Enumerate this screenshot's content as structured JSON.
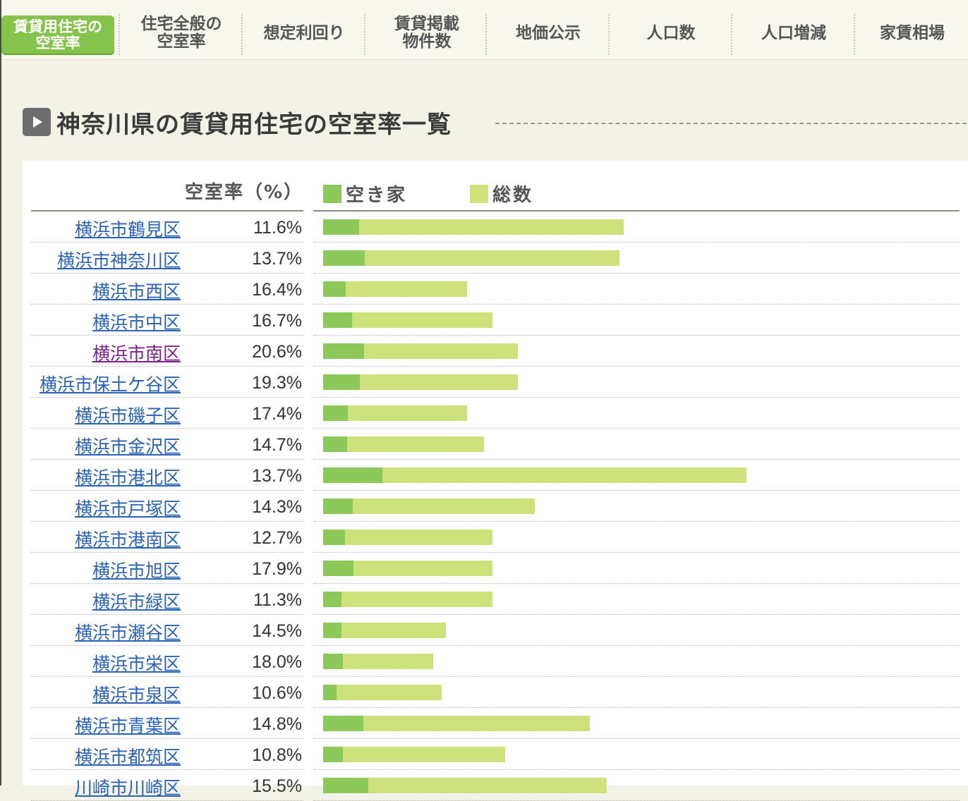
{
  "tabs": [
    {
      "label": "賃貸用住宅の\n空室率",
      "active": true
    },
    {
      "label": "住宅全般の\n空室率",
      "active": false
    },
    {
      "label": "想定利回り",
      "active": false
    },
    {
      "label": "賃貸掲載\n物件数",
      "active": false
    },
    {
      "label": "地価公示",
      "active": false
    },
    {
      "label": "人口数",
      "active": false
    },
    {
      "label": "人口増減",
      "active": false
    },
    {
      "label": "家賃相場",
      "active": false
    }
  ],
  "section": {
    "title": "神奈川県の賃貸用住宅の空室率一覧",
    "icon": "play-icon"
  },
  "table": {
    "rate_header": "空室率（%）"
  },
  "colors": {
    "vacant": "#8cc95a",
    "total": "#cde27a",
    "link": "#2a63b8",
    "visited_link": "#7d1f8c",
    "active_tab": "#86c34d"
  },
  "chart_data": {
    "type": "bar",
    "orientation": "horizontal",
    "stacked": "overlay",
    "legend": [
      {
        "name": "空き家",
        "color": "#8cc95a"
      },
      {
        "name": "総数",
        "color": "#cde27a"
      }
    ],
    "categories": [
      "横浜市鶴見区",
      "横浜市神奈川区",
      "横浜市西区",
      "横浜市中区",
      "横浜市南区",
      "横浜市保土ケ谷区",
      "横浜市磯子区",
      "横浜市金沢区",
      "横浜市港北区",
      "横浜市戸塚区",
      "横浜市港南区",
      "横浜市旭区",
      "横浜市緑区",
      "横浜市瀬谷区",
      "横浜市栄区",
      "横浜市泉区",
      "横浜市青葉区",
      "横浜市都筑区",
      "川崎市川崎区"
    ],
    "rates": [
      "11.6%",
      "13.7%",
      "16.4%",
      "16.7%",
      "20.6%",
      "19.3%",
      "17.4%",
      "14.7%",
      "13.7%",
      "14.3%",
      "12.7%",
      "17.9%",
      "11.3%",
      "14.5%",
      "18.0%",
      "10.6%",
      "14.8%",
      "10.8%",
      "15.5%"
    ],
    "visited": [
      false,
      false,
      false,
      false,
      true,
      false,
      false,
      false,
      false,
      false,
      false,
      false,
      false,
      false,
      false,
      false,
      false,
      false,
      false
    ],
    "series": [
      {
        "name": "総数",
        "values": [
          71,
          70,
          34,
          40,
          46,
          46,
          34,
          38,
          100,
          50,
          40,
          40,
          40,
          29,
          26,
          28,
          63,
          43,
          67
        ]
      },
      {
        "name": "空き家",
        "values": [
          8.5,
          9.8,
          5.3,
          6.8,
          9.7,
          8.7,
          5.8,
          5.7,
          14,
          7,
          5.2,
          7.2,
          4.3,
          4.3,
          4.7,
          3.2,
          9.5,
          4.7,
          10.7
        ]
      }
    ],
    "xlim": [
      0,
      100
    ]
  }
}
